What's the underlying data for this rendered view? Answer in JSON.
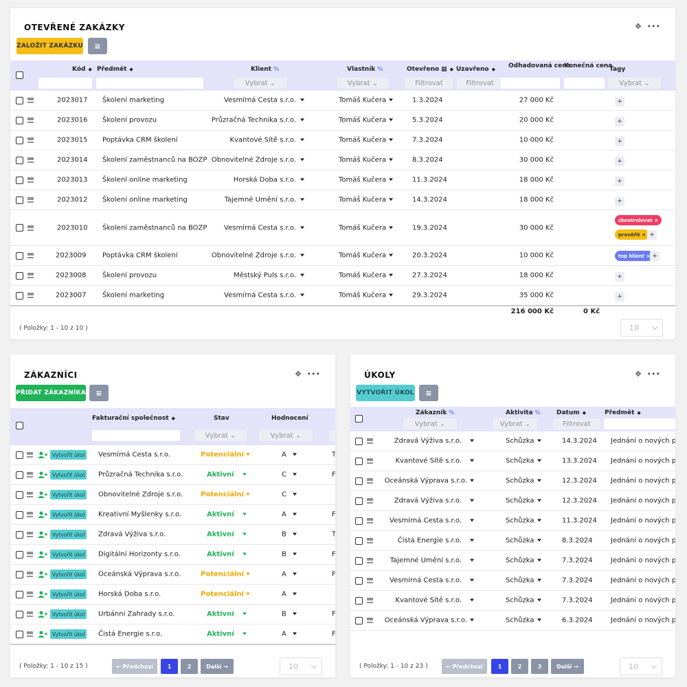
{
  "orders": {
    "title": "OTEVŘENÉ ZAKÁZKY",
    "create_button": "ZALOŽIT ZAKÁZKU",
    "menu_button": "≡",
    "columns": {
      "code": "Kód",
      "subject": "Předmět",
      "client": "Klient",
      "owner": "Vlastník",
      "opened": "Otevřeno",
      "closed": "Uzavřeno",
      "estimated": "Odhadovaná cena",
      "final": "Konečná cena",
      "tags": "Tagy"
    },
    "filters": {
      "select": "Vybrat",
      "filter": "Filtrovat"
    },
    "rows": [
      {
        "code": "2023017",
        "subject": "Školení marketing",
        "client": "Vesmírná Cesta s.r.o.",
        "owner": "Tomáš Kučera",
        "opened": "1.3.2024",
        "estimated": "27 000 Kč"
      },
      {
        "code": "2023016",
        "subject": "Školení provozu",
        "client": "Průzračná Technika s.r.o.",
        "owner": "Tomáš Kučera",
        "opened": "5.3.2024",
        "estimated": "20 000 Kč"
      },
      {
        "code": "2023015",
        "subject": "Poptávka CRM školení",
        "client": "Kvantové Sítě s.r.o.",
        "owner": "Tomáš Kučera",
        "opened": "7.3.2024",
        "estimated": "10 000 Kč"
      },
      {
        "code": "2023014",
        "subject": "Školení zaměstnanců na BOZP",
        "client": "Obnovitelné Zdroje s.r.o.",
        "owner": "Tomáš Kučera",
        "opened": "8.3.2024",
        "estimated": "30 000 Kč"
      },
      {
        "code": "2023013",
        "subject": "Školení online marketing",
        "client": "Horská Doba s.r.o.",
        "owner": "Tomáš Kučera",
        "opened": "11.3.2024",
        "estimated": "18 000 Kč"
      },
      {
        "code": "2023012",
        "subject": "Školení online marketing",
        "client": "Tajemné Umění s.r.o.",
        "owner": "Tomáš Kučera",
        "opened": "14.3.2024",
        "estimated": "18 000 Kč"
      },
      {
        "code": "2023010",
        "subject": "Školení zaměstnanců na BOZP",
        "client": "Vesmírná Cesta s.r.o.",
        "owner": "Tomáš Kučera",
        "opened": "19.3.2024",
        "estimated": "30 000 Kč"
      },
      {
        "code": "2023009",
        "subject": "Poptávka CRM školení",
        "client": "Obnovitelné Zdroje s.r.o.",
        "owner": "Tomáš Kučera",
        "opened": "20.3.2024",
        "estimated": "10 000 Kč"
      },
      {
        "code": "2023008",
        "subject": "Školení provozu",
        "client": "Městský Puls s.r.o.",
        "owner": "Tomáš Kučera",
        "opened": "27.3.2024",
        "estimated": "18 000 Kč"
      },
      {
        "code": "2023007",
        "subject": "Školení marketing",
        "client": "Vesmírná Cesta s.r.o.",
        "owner": "Tomáš Kučera",
        "opened": "29.3.2024",
        "estimated": "35 000 Kč"
      }
    ],
    "tags": {
      "t1": "zkontrolovat ×",
      "t2": "prověřit ×",
      "t3": "top klient ×",
      "plus": "+"
    },
    "total_estimated": "216 000 Kč",
    "total_final": "0 Kč",
    "items_info": "( Položky: 1 - 10 z 10 )",
    "page_size": "10"
  },
  "customers": {
    "title": "ZÁKAZNÍCI",
    "add_button": "PŘIDAT ZÁKAZNÍKA",
    "menu_button": "≡",
    "columns": {
      "company": "Fakturační společnost",
      "status": "Stav",
      "rating": "Hodnocení"
    },
    "filters": {
      "select": "Vybrat"
    },
    "task_button": "Vytvořit úkol",
    "rows": [
      {
        "company": "Vesmírná Cesta s.r.o.",
        "status": "Potenciální",
        "rating": "A",
        "extra": "T"
      },
      {
        "company": "Průzračná Technika s.r.o.",
        "status": "Aktivní",
        "rating": "C",
        "extra": "F"
      },
      {
        "company": "Obnovitelné Zdroje s.r.o.",
        "status": "Potenciální",
        "rating": "C",
        "extra": ""
      },
      {
        "company": "Kreativní Myšlenky s.r.o.",
        "status": "Aktivní",
        "rating": "A",
        "extra": "F"
      },
      {
        "company": "Zdravá Výživa s.r.o.",
        "status": "Aktivní",
        "rating": "B",
        "extra": "T"
      },
      {
        "company": "Digitální Horizonty s.r.o.",
        "status": "Aktivní",
        "rating": "B",
        "extra": "F"
      },
      {
        "company": "Oceánská Výprava s.r.o.",
        "status": "Potenciální",
        "rating": "A",
        "extra": "F"
      },
      {
        "company": "Horská Doba s.r.o.",
        "status": "Potenciální",
        "rating": "A",
        "extra": ""
      },
      {
        "company": "Urbánní Zahrady s.r.o.",
        "status": "Aktivní",
        "rating": "B",
        "extra": "F"
      },
      {
        "company": "Čistá Energie s.r.o.",
        "status": "Aktivní",
        "rating": "A",
        "extra": "F"
      }
    ],
    "items_info": "( Položky: 1 - 10 z 15 )",
    "prev": "← Předchozí",
    "next": "Další →",
    "pages": [
      "1",
      "2"
    ],
    "page_size": "10"
  },
  "tasks": {
    "title": "ÚKOLY",
    "create_button": "VYTVOŘIT ÚKOL",
    "menu_button": "≡",
    "columns": {
      "customer": "Zákazník",
      "activity": "Aktivita",
      "date": "Datum",
      "subject": "Předmět"
    },
    "filters": {
      "select": "Vybrat",
      "filter": "Filtrovat"
    },
    "rows": [
      {
        "customer": "Zdravá Výživa s.r.o.",
        "activity": "Schůzka",
        "date": "14.3.2024",
        "subject": "Jednání o nových pro"
      },
      {
        "customer": "Kvantové Sítě s.r.o.",
        "activity": "Schůzka",
        "date": "13.3.2024",
        "subject": "Jednání o nových pro"
      },
      {
        "customer": "Oceánská Výprava s.r.o.",
        "activity": "Schůzka",
        "date": "12.3.2024",
        "subject": "Jednání o nových pro"
      },
      {
        "customer": "Zdravá Výživa s.r.o.",
        "activity": "Schůzka",
        "date": "12.3.2024",
        "subject": "Jednání o nových pro"
      },
      {
        "customer": "Vesmírná Cesta s.r.o.",
        "activity": "Schůzka",
        "date": "11.3.2024",
        "subject": "Jednání o nových pro"
      },
      {
        "customer": "Čistá Energie s.r.o.",
        "activity": "Schůzka",
        "date": "8.3.2024",
        "subject": "Jednání o nových pro"
      },
      {
        "customer": "Tajemné Umění s.r.o.",
        "activity": "Schůzka",
        "date": "7.3.2024",
        "subject": "Jednání o nových pro"
      },
      {
        "customer": "Vesmírná Cesta s.r.o.",
        "activity": "Schůzka",
        "date": "7.3.2024",
        "subject": "Jednání o nových pro"
      },
      {
        "customer": "Kvantové Sítě s.r.o.",
        "activity": "Schůzka",
        "date": "7.3.2024",
        "subject": "Jednání o nových pro"
      },
      {
        "customer": "Oceánská Výprava s.r.o.",
        "activity": "Schůzka",
        "date": "6.3.2024",
        "subject": "Jednání o nových pro"
      }
    ],
    "items_info": "( Položky: 1 - 10 z 23 )",
    "prev": "← Předchozí",
    "next": "Další →",
    "pages": [
      "1",
      "2",
      "3"
    ],
    "page_size": "10"
  },
  "colors": {
    "accent": "#3745e6",
    "header_bg": "#e3e4fa",
    "potential": "#f1a800",
    "active": "#21b25a"
  },
  "icons": {
    "move": "move-icon",
    "more": "more-icon",
    "menu": "menu-icon",
    "calendar": "calendar-icon",
    "link": "link-icon",
    "add_user": "add-user-icon"
  }
}
